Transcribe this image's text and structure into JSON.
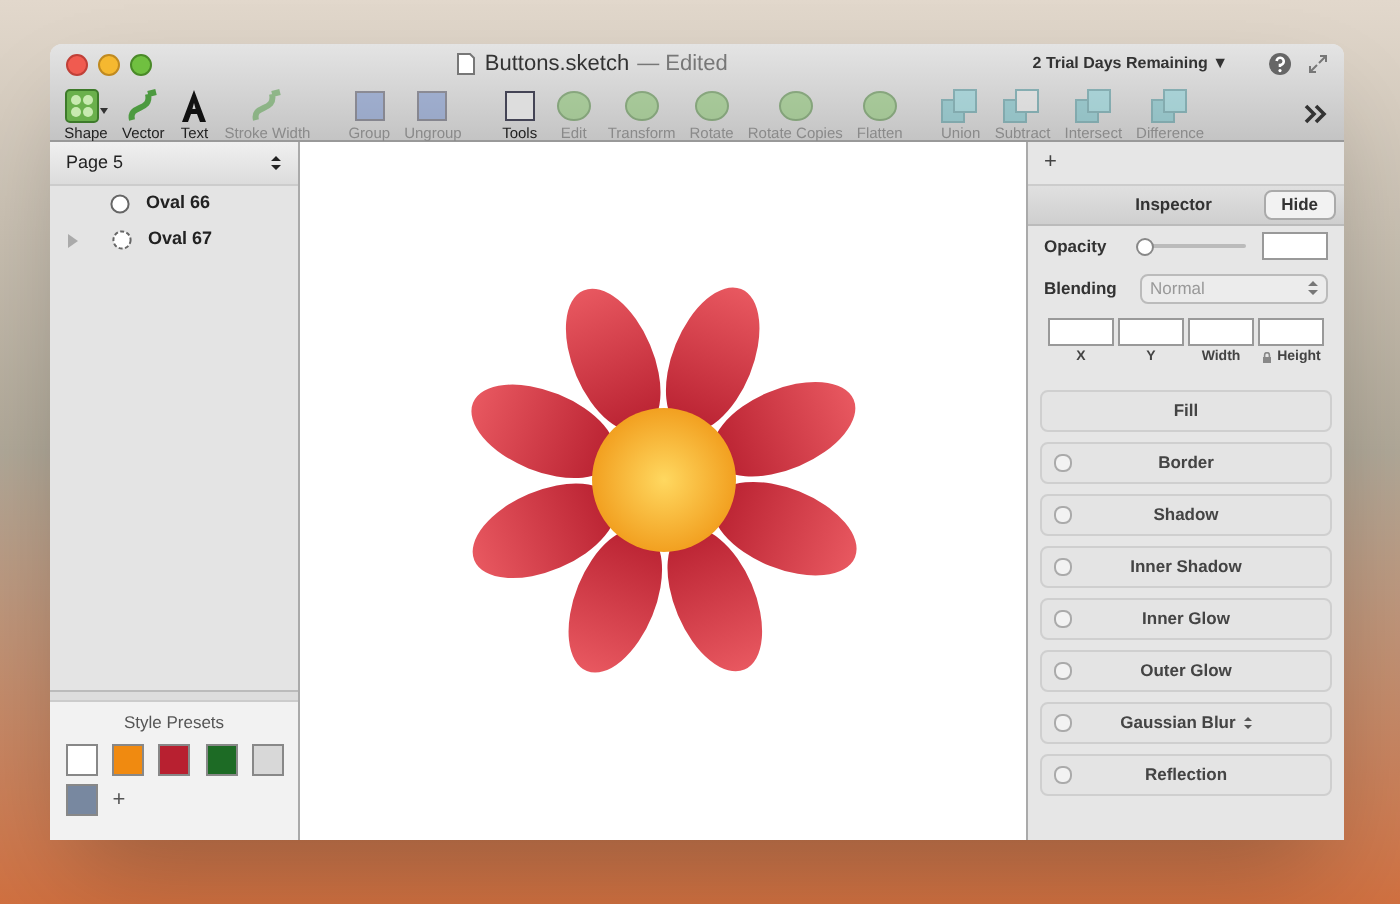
{
  "window": {
    "title": "Buttons.sketch",
    "status": "— Edited",
    "trial": "2 Trial Days Remaining ▼"
  },
  "toolbar": [
    {
      "label": "Shape",
      "disabled": false
    },
    {
      "label": "Vector",
      "disabled": false
    },
    {
      "label": "Text",
      "disabled": false
    },
    {
      "label": "Stroke Width",
      "disabled": true
    },
    {
      "label": "Group",
      "disabled": true
    },
    {
      "label": "Ungroup",
      "disabled": true
    },
    {
      "label": "Tools",
      "disabled": false
    },
    {
      "label": "Edit",
      "disabled": true
    },
    {
      "label": "Transform",
      "disabled": true
    },
    {
      "label": "Rotate",
      "disabled": true
    },
    {
      "label": "Rotate Copies",
      "disabled": true
    },
    {
      "label": "Flatten",
      "disabled": true
    },
    {
      "label": "Union",
      "disabled": true
    },
    {
      "label": "Subtract",
      "disabled": true
    },
    {
      "label": "Intersect",
      "disabled": true
    },
    {
      "label": "Difference",
      "disabled": true
    }
  ],
  "sidebar": {
    "page": "Page 5",
    "layers": [
      {
        "name": "Oval 66",
        "kind": "circle",
        "has_children": false
      },
      {
        "name": "Oval 67",
        "kind": "star",
        "expanded": false,
        "has_children": true
      }
    ],
    "presets_title": "Style Presets",
    "presets": [
      {
        "color": "#ffffff"
      },
      {
        "color": "#f08a10"
      },
      {
        "color": "#b82030"
      },
      {
        "color": "#1d6b25"
      },
      {
        "color": "#d8d8d8"
      },
      {
        "color": "#7888a0"
      }
    ],
    "add": "+"
  },
  "inspector": {
    "add": "+",
    "title": "Inspector",
    "hide": "Hide",
    "opacity": {
      "label": "Opacity",
      "level": 0.05
    },
    "blending": {
      "label": "Blending",
      "value": "Normal"
    },
    "fields": [
      "X",
      "Y",
      "Width",
      "Height"
    ],
    "sections": [
      {
        "label": "Fill",
        "kind": "plain"
      },
      {
        "label": "Border",
        "kind": "checkbox",
        "checked": false
      },
      {
        "label": "Shadow",
        "kind": "checkbox",
        "checked": false
      },
      {
        "label": "Inner Shadow",
        "kind": "checkbox",
        "checked": false
      },
      {
        "label": "Inner Glow",
        "kind": "checkbox",
        "checked": false
      },
      {
        "label": "Outer Glow",
        "kind": "checkbox",
        "checked": false
      },
      {
        "label": "Gaussian Blur",
        "kind": "select",
        "checked": false
      },
      {
        "label": "Reflection",
        "kind": "checkbox",
        "checked": false
      }
    ]
  }
}
